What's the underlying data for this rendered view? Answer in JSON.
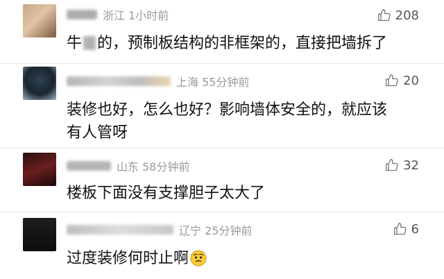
{
  "colors": {
    "meta": "#9a9a9a",
    "text": "#111111",
    "divider": "#e6e6e6"
  },
  "comments": [
    {
      "location_time": "浙江 1小时前",
      "likes": "208",
      "text_a": "牛",
      "text_b": "的，预制板结构的非框架的，直接把墙拆了",
      "avatar_icon": "user-avatar-blurred"
    },
    {
      "location_time": "上海 55分钟前",
      "likes": "20",
      "line1": "装修也好，怎么也好？影响墙体安全的，就应该",
      "line2": "有人管呀",
      "avatar_icon": "user-avatar-blurred"
    },
    {
      "location_time": "山东 58分钟前",
      "likes": "32",
      "text": "楼板下面没有支撑胆子太大了",
      "avatar_icon": "user-avatar-blurred"
    },
    {
      "location_time": "辽宁 25分钟前",
      "likes": "6",
      "text": "过度装修何时止啊",
      "emoji_icon": "worried-face-emoji"
    }
  ]
}
